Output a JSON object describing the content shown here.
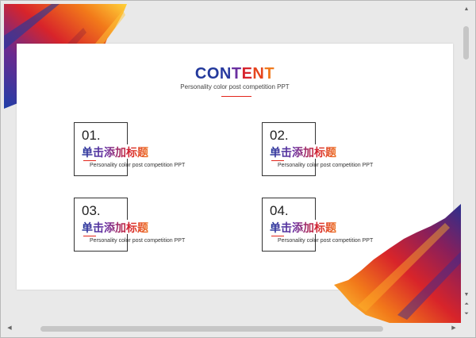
{
  "slide": {
    "title_letters": [
      "C",
      "O",
      "N",
      "T",
      "E",
      "N",
      "T"
    ],
    "title_colors": [
      "#23399c",
      "#23399c",
      "#2a3ba0",
      "#6a2fa0",
      "#d7242d",
      "#e6451d",
      "#f07a1e"
    ],
    "subtitle": "Personality color post competition PPT",
    "accent_color": "#e3261b",
    "cards": [
      {
        "number": "01.",
        "heading": "单击添加标题",
        "desc": "Personality color post competition PPT"
      },
      {
        "number": "02.",
        "heading": "单击添加标题",
        "desc": "Personality color post competition PPT"
      },
      {
        "number": "03.",
        "heading": "单击添加标题",
        "desc": "Personality color post competition PPT"
      },
      {
        "number": "04.",
        "heading": "单击添加标题",
        "desc": "Personality color post competition PPT"
      }
    ]
  },
  "scrollbars": {
    "up_icon": "triangle-up-icon",
    "down_icon": "triangle-down-icon",
    "prev_page_icon": "double-chevron-up-icon",
    "next_page_icon": "double-chevron-down-icon",
    "left_icon": "triangle-left-icon",
    "right_icon": "triangle-right-icon"
  }
}
